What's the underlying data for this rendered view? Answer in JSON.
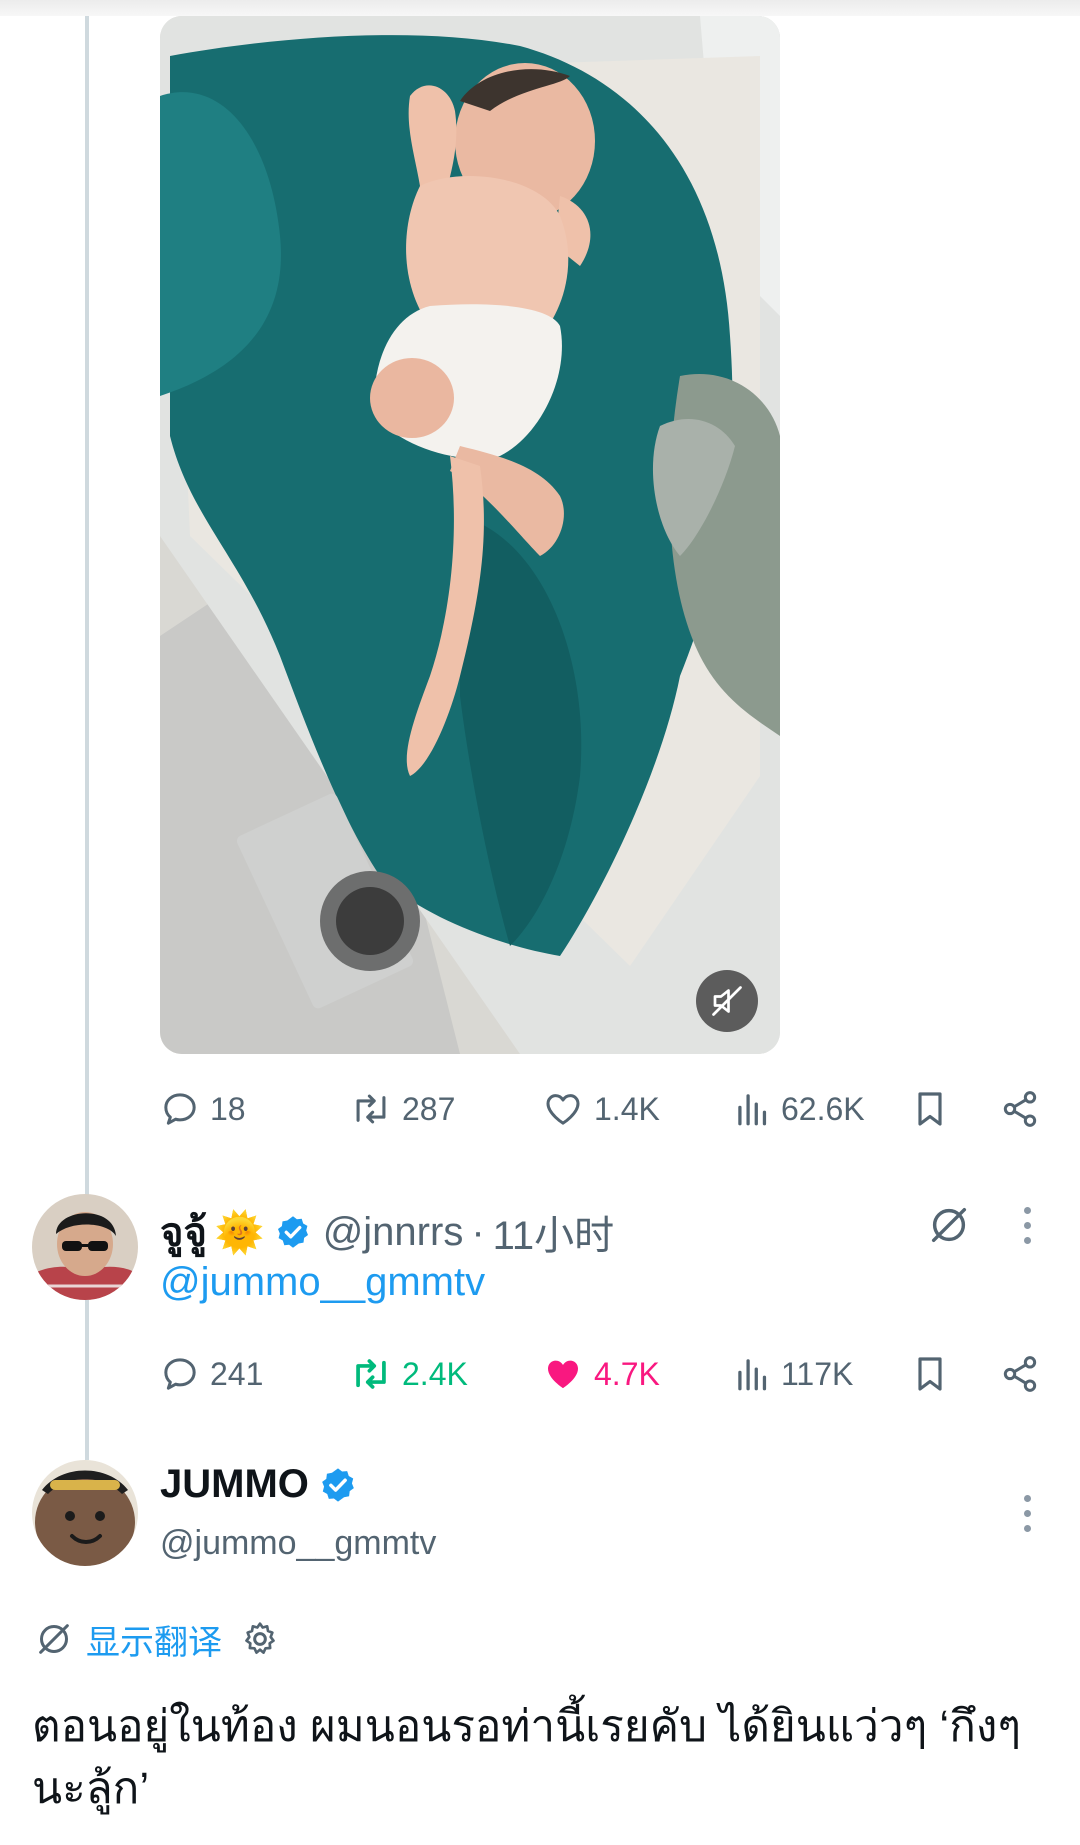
{
  "media": {
    "mute_icon": "muted-speaker-icon"
  },
  "post1_actions": {
    "replies": "18",
    "reposts": "287",
    "likes": "1.4K",
    "views": "62.6K"
  },
  "reply1": {
    "display_name": "จูจู้",
    "emoji": "🌞",
    "handle": "@jnnrrs",
    "separator": "·",
    "time": "11小时",
    "mention": "@jummo__gmmtv",
    "actions": {
      "replies": "241",
      "reposts": "2.4K",
      "likes": "4.7K",
      "views": "117K"
    }
  },
  "reply2": {
    "display_name": "JUMMO",
    "handle": "@jummo__gmmtv",
    "translate_label": "显示翻译",
    "text": "ตอนอยู่ในท้อง ผมนอนรอท่านี้เรยคับ ได้ยินแว่วๆ ‘กึงๆ นะลู้ก’"
  },
  "colors": {
    "accent_blue": "#1d9bf0",
    "repost_green": "#00ba7c",
    "like_pink": "#f91880",
    "muted_gray": "#536471"
  }
}
